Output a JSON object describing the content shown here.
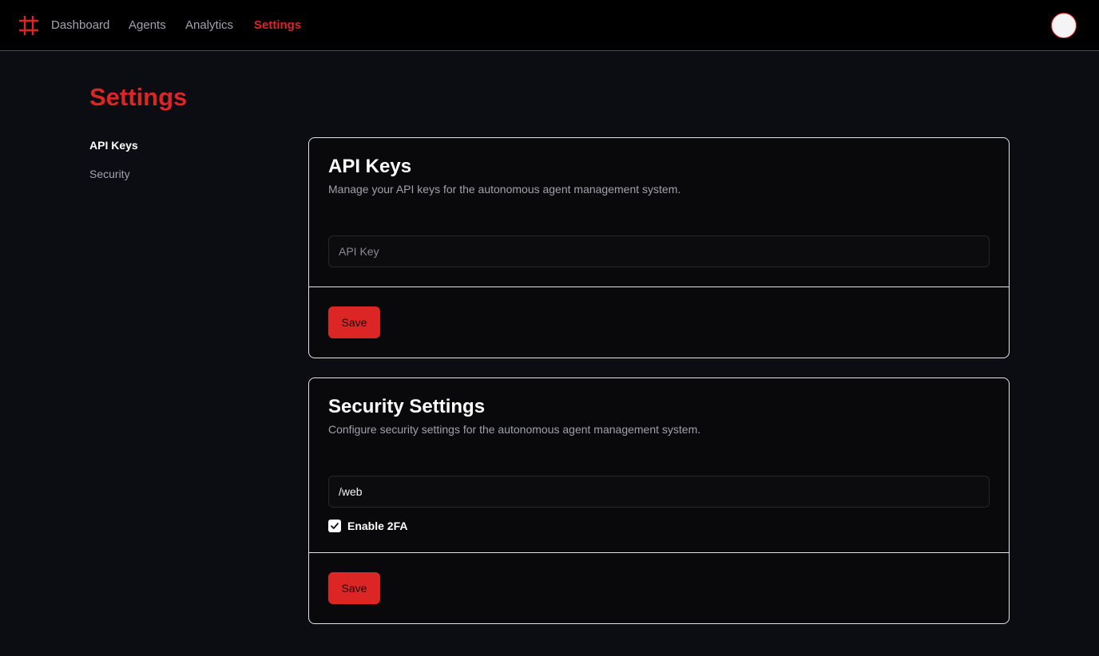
{
  "nav": {
    "links": [
      "Dashboard",
      "Agents",
      "Analytics",
      "Settings"
    ],
    "active": "Settings"
  },
  "page": {
    "title": "Settings"
  },
  "sidebar": {
    "items": [
      "API Keys",
      "Security"
    ],
    "active": "API Keys"
  },
  "api_keys_card": {
    "title": "API Keys",
    "description": "Manage your API keys for the autonomous agent management system.",
    "input_placeholder": "API Key",
    "input_value": "",
    "save_label": "Save"
  },
  "security_card": {
    "title": "Security Settings",
    "description": "Configure security settings for the autonomous agent management system.",
    "input_value": "/web",
    "checkbox_label": "Enable 2FA",
    "checkbox_checked": true,
    "save_label": "Save"
  },
  "colors": {
    "accent": "#dc2626",
    "background": "#0b0d13",
    "card": "#09090b",
    "topbar": "#000000"
  },
  "icons": {
    "logo": "hash-grid-icon",
    "check": "check-icon"
  }
}
